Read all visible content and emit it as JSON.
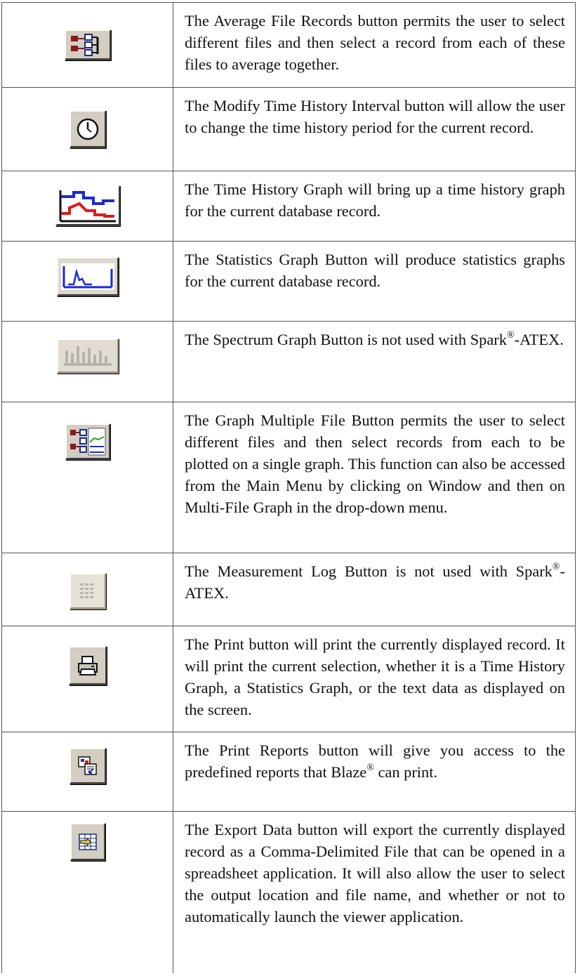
{
  "rows": [
    {
      "icon": "average-file-records-icon",
      "text": "The Average File Records button permits the user to select different files and then select a record from each of these files to average together."
    },
    {
      "icon": "clock-icon",
      "text": "The Modify Time History Interval button will allow the user to change the time history period for the current record."
    },
    {
      "icon": "time-history-graph-icon",
      "text": "The Time History Graph will bring up a time history graph for the current database record."
    },
    {
      "icon": "statistics-graph-icon",
      "text": "The Statistics Graph Button will produce statistics graphs for the current database record."
    },
    {
      "icon": "spectrum-graph-icon",
      "text_before": "The Spectrum Graph Button is not used with Spark",
      "sup": "®",
      "text_after": "-ATEX."
    },
    {
      "icon": "graph-multiple-file-icon",
      "text": "The Graph Multiple File Button permits the user to select different files and then select records from each to be plotted on a single graph. This function can also be accessed from the Main Menu by clicking on Window and then on Multi-File Graph in the drop-down menu."
    },
    {
      "icon": "measurement-log-icon",
      "text_before": "The Measurement Log Button is not used with Spark",
      "sup": "®",
      "text_after": "-ATEX."
    },
    {
      "icon": "printer-icon",
      "text": "The Print button will print the currently displayed record. It will print the current selection, whether it is a Time History Graph, a Statistics Graph, or the text data as displayed on the screen."
    },
    {
      "icon": "print-reports-icon",
      "text_before": "The Print Reports button will give you access to the predefined reports that Blaze",
      "sup": "®",
      "text_after": " can print."
    },
    {
      "icon": "export-data-icon",
      "text": "The Export Data button will export the currently displayed record as a Comma-Delimited File that can be opened in a spreadsheet application. It will also allow the user to select the output location and file name, and whether or not to automatically launch the viewer application."
    }
  ]
}
